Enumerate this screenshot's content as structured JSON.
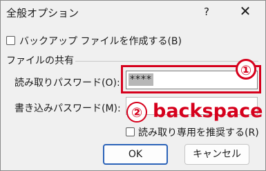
{
  "window": {
    "title": "全般オプション",
    "help_glyph": "?",
    "close_glyph": "✕"
  },
  "options": {
    "backup_label": "バックアップ ファイルを作成する(B)",
    "backup_checked": false
  },
  "sharing": {
    "group_label": "ファイルの共有",
    "read_password_label": "読み取りパスワード(O):",
    "read_password_value": "****",
    "write_password_label": "書き込みパスワード(M):",
    "write_password_value": "",
    "readonly_recommended_label": "読み取り専用を推奨する(R)",
    "readonly_recommended_checked": false
  },
  "annotations": {
    "step1": "①",
    "step2": "②",
    "step2_text": "backspace",
    "accent_color": "#d6001c"
  },
  "buttons": {
    "ok": "OK",
    "cancel": "キャンセル"
  }
}
